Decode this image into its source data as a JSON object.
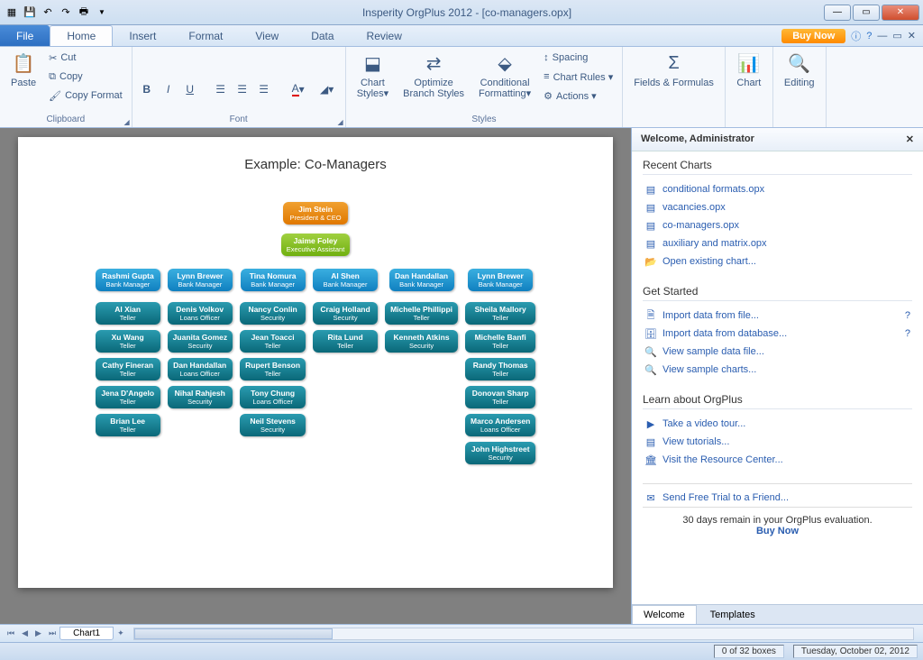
{
  "title": "Insperity OrgPlus 2012 - [co-managers.opx]",
  "menubar": {
    "file": "File",
    "tabs": [
      "Home",
      "Insert",
      "Format",
      "View",
      "Data",
      "Review"
    ],
    "active_tab": "Home",
    "buy_now": "Buy Now"
  },
  "ribbon": {
    "clipboard": {
      "label": "Clipboard",
      "paste": "Paste",
      "cut": "Cut",
      "copy": "Copy",
      "copy_format": "Copy Format"
    },
    "font": {
      "label": "Font"
    },
    "styles": {
      "label": "Styles",
      "chart_styles": "Chart\nStyles▾",
      "optimize": "Optimize\nBranch Styles",
      "conditional": "Conditional\nFormatting▾",
      "spacing": "Spacing",
      "chart_rules": "Chart Rules ▾",
      "actions": "Actions ▾"
    },
    "fields": {
      "label": "Fields & Formulas"
    },
    "chart": {
      "label": "Chart"
    },
    "editing": {
      "label": "Editing"
    }
  },
  "chart_data": {
    "type": "org-chart",
    "title": "Example: Co-Managers",
    "ceo": {
      "name": "Jim Stein",
      "role": "President & CEO"
    },
    "assistant": {
      "name": "Jaime Foley",
      "role": "Executive Assistant"
    },
    "managers": [
      {
        "name": "Rashmi Gupta",
        "role": "Bank Manager",
        "column": 0
      },
      {
        "name": "Lynn Brewer",
        "role": "Bank Manager",
        "column": 0,
        "pair": true
      },
      {
        "name": "Tina Nomura",
        "role": "Bank Manager",
        "column": 1
      },
      {
        "name": "Al Shen",
        "role": "Bank Manager",
        "column": 2
      },
      {
        "name": "Dan Handallan",
        "role": "Bank Manager",
        "column": 3
      },
      {
        "name": "Lynn Brewer",
        "role": "Bank Manager",
        "column": 4
      }
    ],
    "columns": [
      {
        "pairs": [
          [
            {
              "name": "Al Xian",
              "role": "Teller"
            },
            {
              "name": "Denis Volkov",
              "role": "Loans Officer"
            }
          ],
          [
            {
              "name": "Xu Wang",
              "role": "Teller"
            },
            {
              "name": "Juanita Gomez",
              "role": "Security"
            }
          ],
          [
            {
              "name": "Cathy Fineran",
              "role": "Teller"
            },
            {
              "name": "Dan Handallan",
              "role": "Loans Officer"
            }
          ],
          [
            {
              "name": "Jena D'Angelo",
              "role": "Teller"
            },
            {
              "name": "Nihal Rahjesh",
              "role": "Security"
            }
          ],
          [
            {
              "name": "Brian Lee",
              "role": "Teller"
            }
          ]
        ]
      },
      {
        "employees": [
          {
            "name": "Nancy Conlin",
            "role": "Security"
          },
          {
            "name": "Jean Toacci",
            "role": "Teller"
          },
          {
            "name": "Rupert Benson",
            "role": "Teller"
          },
          {
            "name": "Tony Chung",
            "role": "Loans Officer"
          },
          {
            "name": "Neil Stevens",
            "role": "Security"
          }
        ]
      },
      {
        "employees": [
          {
            "name": "Craig Holland",
            "role": "Security"
          },
          {
            "name": "Rita Lund",
            "role": "Teller"
          }
        ]
      },
      {
        "employees": [
          {
            "name": "Michelle Phillippi",
            "role": "Teller"
          },
          {
            "name": "Kenneth Atkins",
            "role": "Security"
          }
        ]
      },
      {
        "employees": [
          {
            "name": "Sheila Mallory",
            "role": "Teller"
          },
          {
            "name": "Michelle Banfi",
            "role": "Teller"
          },
          {
            "name": "Randy Thomas",
            "role": "Teller"
          },
          {
            "name": "Donovan Sharp",
            "role": "Teller"
          },
          {
            "name": "Marco Andersen",
            "role": "Loans Officer"
          },
          {
            "name": "John Highstreet",
            "role": "Security"
          }
        ]
      }
    ]
  },
  "sidepanel": {
    "header": "Welcome, Administrator",
    "recent": {
      "title": "Recent Charts",
      "items": [
        "conditional formats.opx",
        "vacancies.opx",
        "co-managers.opx",
        "auxiliary and matrix.opx"
      ],
      "open": "Open existing chart..."
    },
    "getstarted": {
      "title": "Get Started",
      "items": [
        "Import data from file...",
        "Import data from database...",
        "View sample data file...",
        "View sample charts..."
      ]
    },
    "learn": {
      "title": "Learn about OrgPlus",
      "items": [
        "Take a video tour...",
        "View tutorials...",
        "Visit the Resource Center..."
      ]
    },
    "send": "Send Free Trial to a Friend...",
    "eval": {
      "text": "30 days remain in your OrgPlus evaluation.",
      "buy": "Buy Now"
    },
    "tabs": [
      "Welcome",
      "Templates"
    ]
  },
  "bottom": {
    "sheet": "Chart1"
  },
  "status": {
    "boxes": "0 of 32 boxes",
    "date": "Tuesday, October 02, 2012"
  }
}
